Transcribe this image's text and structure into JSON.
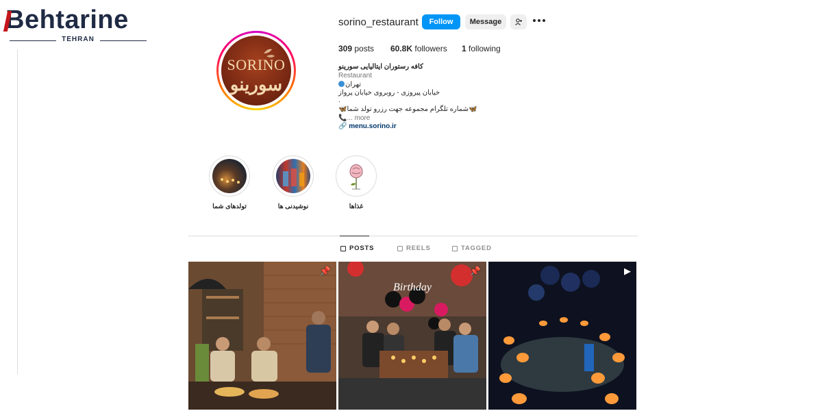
{
  "watermark": {
    "brand": "Behtarine",
    "brand_first": "B",
    "brand_rest": "ehtarine",
    "city": "TEHRAN"
  },
  "profile": {
    "avatar_text": "SORINO",
    "avatar_text_fa": "سورینو",
    "username": "sorino_restaurant",
    "follow_label": "Follow",
    "message_label": "Message",
    "stats": {
      "posts_count": "309",
      "posts_label": "posts",
      "followers_count": "60.8K",
      "followers_label": "followers",
      "following_count": "1",
      "following_label": "following"
    },
    "bio": {
      "name": "کافه رستوران ایتالیایی سورینو",
      "category": "Restaurant",
      "city": "تهران",
      "address": "خیابان پیروزی - روبروی خیابان پرواز",
      "dot": ".",
      "telegram": "شماره تلگرام مجموعه جهت رزرو تولد شما",
      "more": "... more",
      "link": "menu.sorino.ir"
    }
  },
  "highlights": [
    {
      "label": "تولدهای شما"
    },
    {
      "label": "نوشیدنی ها"
    },
    {
      "label": "غذاها"
    }
  ],
  "tabs": [
    {
      "label": "POSTS",
      "active": true
    },
    {
      "label": "REELS",
      "active": false
    },
    {
      "label": "TAGGED",
      "active": false
    }
  ],
  "posts": [
    {
      "badge_icon": "pin-icon",
      "badge_glyph": "📌"
    },
    {
      "badge_icon": "pin-icon",
      "badge_glyph": "📌"
    },
    {
      "badge_icon": "reel-icon",
      "badge_glyph": "▶"
    }
  ],
  "colors": {
    "primary": "#0095f6",
    "brand_dark": "#1f2a44",
    "brand_red": "#c4161c"
  }
}
